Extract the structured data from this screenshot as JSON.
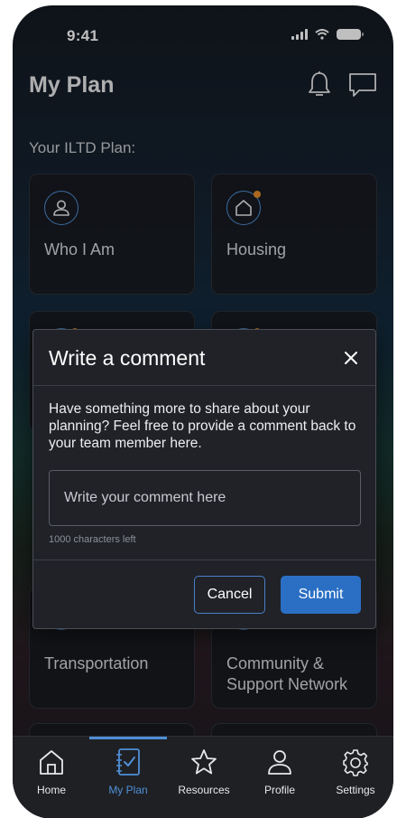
{
  "status_bar": {
    "time": "9:41"
  },
  "header": {
    "title": "My Plan"
  },
  "section_label": "Your ILTD Plan:",
  "cards": [
    {
      "label": "Who I Am",
      "icon": "person-icon",
      "badge": false
    },
    {
      "label": "Housing",
      "icon": "house-icon",
      "badge": true
    },
    {
      "label": "Transportation",
      "icon": "",
      "badge": false
    },
    {
      "label": "Community & Support Network",
      "icon": "",
      "badge": false
    }
  ],
  "modal": {
    "title": "Write a comment",
    "body": "Have something more to share about your planning? Feel free to provide a comment back to your team member here.",
    "input_placeholder": "Write your comment here",
    "input_value": "",
    "char_count": "1000 characters left",
    "cancel_label": "Cancel",
    "submit_label": "Submit"
  },
  "tab_bar": {
    "active": "My Plan",
    "tabs": [
      {
        "label": "Home",
        "icon": "home-icon"
      },
      {
        "label": "My Plan",
        "icon": "checklist-icon"
      },
      {
        "label": "Resources",
        "icon": "star-icon"
      },
      {
        "label": "Profile",
        "icon": "person-icon"
      },
      {
        "label": "Settings",
        "icon": "gear-icon"
      }
    ]
  },
  "colors": {
    "accent": "#4f8fd6",
    "submit": "#2a6fc4",
    "badge": "#e58b2a",
    "modal_bg": "#202228",
    "tab_bar_bg": "#1f2024"
  }
}
